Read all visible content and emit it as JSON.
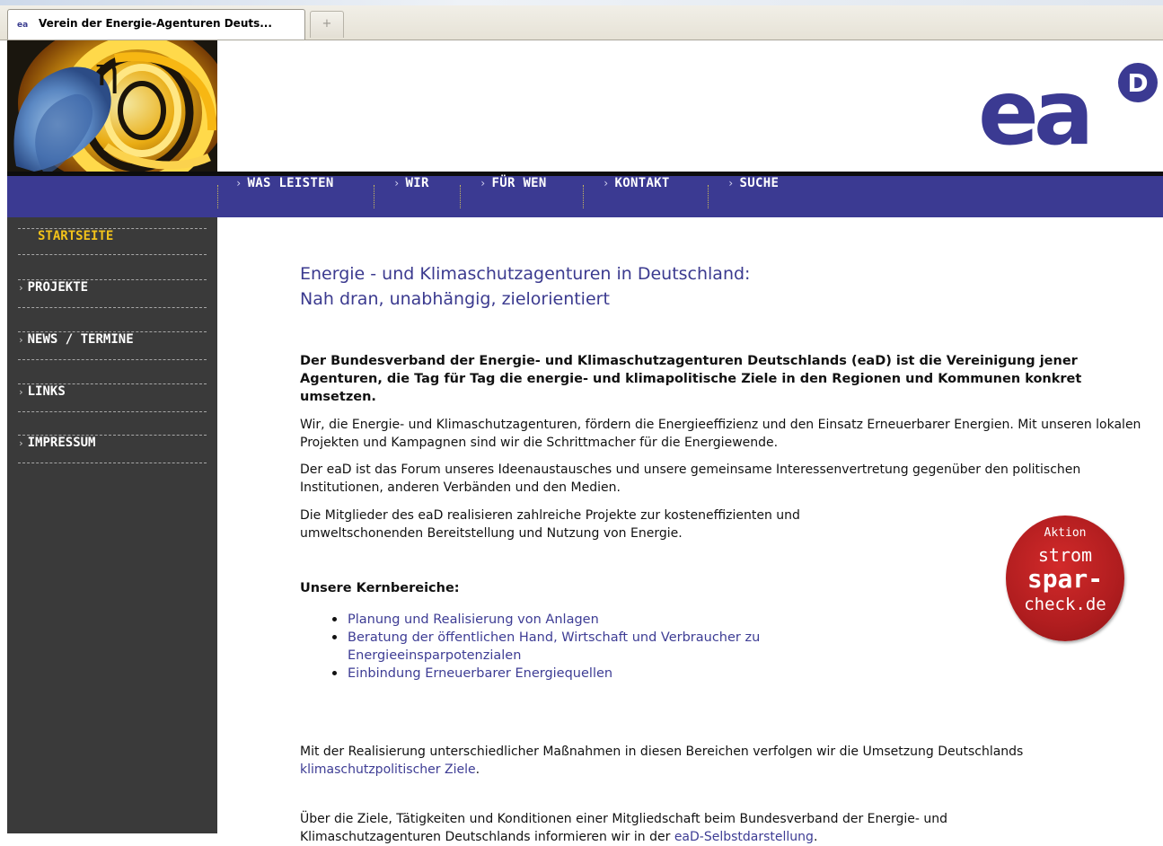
{
  "browser": {
    "tab_title": "Verein der Energie-Agenturen Deuts...",
    "favicon_text": "ea",
    "new_tab_symbol": "+"
  },
  "header": {
    "logo_symbol": "η",
    "ead_logo_text": "ea",
    "ead_logo_superscript": "D",
    "brand_color": "#3b3a92",
    "accent_color": "#f2c21a"
  },
  "nav": {
    "chevron": "›",
    "items": [
      {
        "label": "WAS LEISTEN"
      },
      {
        "label": "WIR"
      },
      {
        "label": "FÜR WEN"
      },
      {
        "label": "KONTAKT"
      },
      {
        "label": "SUCHE"
      }
    ]
  },
  "sidebar": {
    "chevron": "›",
    "items": [
      {
        "label": "STARTSEITE",
        "active": true
      },
      {
        "label": "PROJEKTE"
      },
      {
        "label": "NEWS / TERMINE"
      },
      {
        "label": "LINKS"
      },
      {
        "label": "IMPRESSUM"
      }
    ]
  },
  "content": {
    "headline_1": "Energie - und Klimaschutzagenturen in Deutschland:",
    "headline_2": "Nah dran, unabhängig, zielorientiert",
    "intro_bold": "Der Bundesverband der Energie- und Klimaschutzagenturen Deutschlands (eaD) ist die Vereinigung jener Agenturen, die Tag für Tag die energie- und klimapolitische Ziele in den Regionen und Kommunen konkret umsetzen.",
    "para_1": "Wir, die Energie- und Klimaschutzagenturen, fördern die Energieeffizienz und den Einsatz Erneuerbarer Energien. Mit unseren lokalen Projekten und Kampagnen sind wir die Schrittmacher für die Energiewende.",
    "para_2": "Der eaD ist das Forum unseres Ideenaustausches und unsere gemeinsame Interessenvertretung gegenüber den politischen Institutionen, anderen Verbänden und den Medien.",
    "para_3_line_1": "Die Mitglieder des eaD realisieren zahlreiche Projekte zur kosteneffizienten und",
    "para_3_line_2": "umweltschonenden Bereitstellung und Nutzung von Energie.",
    "kern_heading": "Unsere Kernbereiche:",
    "kern_items": [
      "Planung und Realisierung von Anlagen",
      "Beratung der öffentlichen Hand, Wirtschaft und Verbraucher zu Energieeinsparpotenzialen",
      "Einbindung Erneuerbarer Energiequellen"
    ],
    "para_4_text": "Mit der Realisierung unterschiedlicher Maßnahmen in diesen Bereichen verfolgen wir die Umsetzung Deutschlands ",
    "para_4_link": "klimaschutzpolitischer Ziele",
    "para_4_end": ".",
    "para_5_text": "Über die Ziele, Tätigkeiten und Konditionen einer Mitgliedschaft beim Bundesverband der Energie- und Klimaschutzagenturen Deutschlands informieren wir in der ",
    "para_5_link": "eaD-Selbstdarstellung",
    "para_5_end": "."
  },
  "badge": {
    "line_1": "Aktion",
    "line_2": "strom",
    "line_3": "spar-",
    "line_4": "check.de"
  }
}
